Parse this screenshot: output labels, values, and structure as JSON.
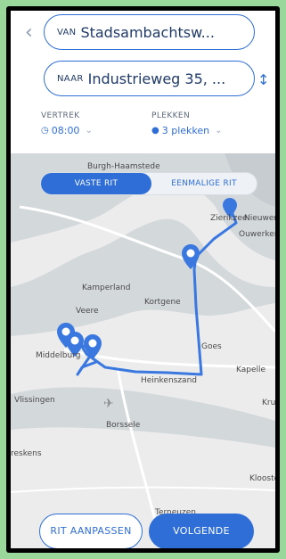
{
  "route": {
    "from_prefix": "VAN",
    "from_value": "Stadsambachtsw...",
    "to_prefix": "NAAR",
    "to_value": "Industrieweg 35, ..."
  },
  "meta": {
    "departure_label": "VERTREK",
    "departure_value": "08:00",
    "seats_label": "PLEKKEN",
    "seats_value": "3 plekken"
  },
  "tabs": {
    "fixed": "VASTE RIT",
    "single": "EENMALIGE RIT"
  },
  "map": {
    "places": {
      "burgh": "Burgh-Haamstede",
      "zierikzee": "Zierikzee",
      "nieuwerk": "Nieuwerk",
      "ouwerkerk": "Ouwerkerk",
      "kamperland": "Kamperland",
      "veere": "Veere",
      "kortgene": "Kortgene",
      "middelburg": "Middelburg",
      "goes": "Goes",
      "kapelle": "Kapelle",
      "heinkenszand": "Heinkenszand",
      "vlissingen": "Vlissingen",
      "kru": "Kru",
      "borssele": "Borssele",
      "breskens": "reskens",
      "kloosterzande": "Klooster",
      "terneuzen": "Terneuzen"
    },
    "route_color": "#3a78e0"
  },
  "actions": {
    "edit": "RIT AANPASSEN",
    "next": "VOLGENDE"
  }
}
